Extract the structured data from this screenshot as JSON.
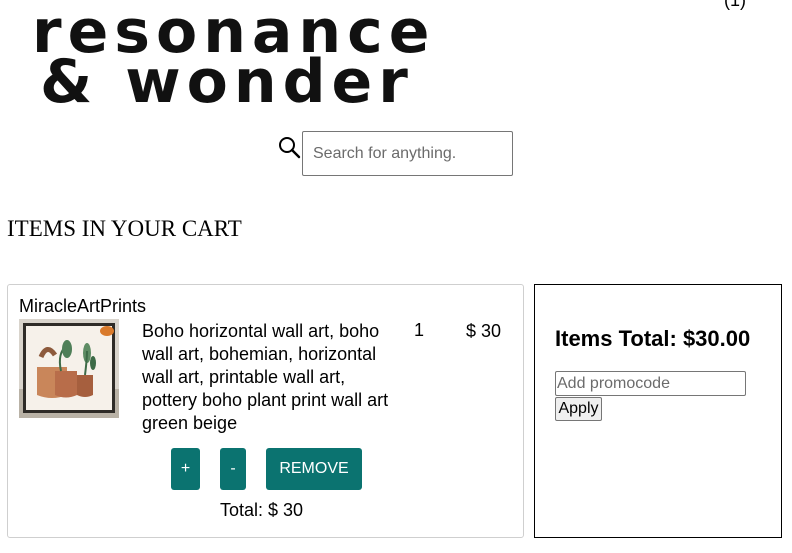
{
  "header": {
    "logo_line1": "resonance",
    "logo_line2": "& wonder",
    "cart_count": "(1)"
  },
  "search": {
    "icon": "search-icon",
    "placeholder": "Search for anything."
  },
  "cart": {
    "heading": "ITEMS IN YOUR CART",
    "items": [
      {
        "shop": "MiracleArtPrints",
        "title": "Boho horizontal wall art, boho wall art, bohemian, horizontal wall art, printable wall art, pottery boho plant print wall art green beige",
        "quantity": "1",
        "price": "$ 30",
        "plus_label": "+",
        "minus_label": "-",
        "remove_label": "REMOVE",
        "total": "Total: $ 30"
      }
    ]
  },
  "summary": {
    "items_total": "Items Total: $30.00",
    "promo_placeholder": "Add promocode",
    "apply_label": "Apply"
  },
  "colors": {
    "button_teal": "#0b7370",
    "border_light": "#cfcfcf"
  }
}
